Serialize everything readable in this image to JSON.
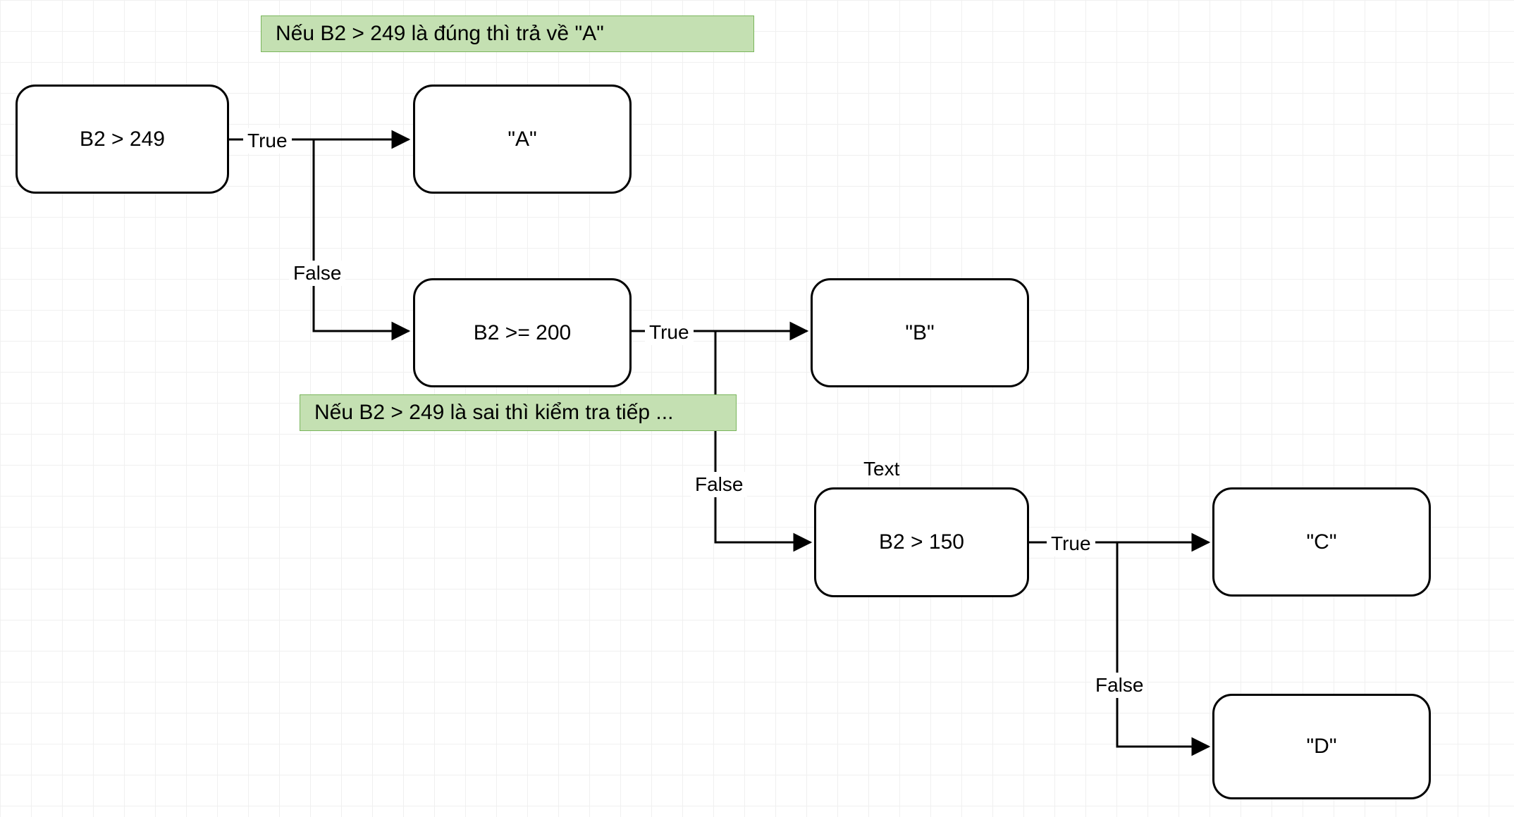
{
  "nodes": {
    "cond1": {
      "text": "B2 > 249"
    },
    "resA": {
      "text": "\"A\""
    },
    "cond2": {
      "text": "B2 >= 200"
    },
    "resB": {
      "text": "\"B\""
    },
    "cond3": {
      "text": "B2 > 150"
    },
    "resC": {
      "text": "\"C\""
    },
    "resD": {
      "text": "\"D\""
    }
  },
  "callouts": {
    "top": "Nếu B2 > 249 là đúng thì trả về \"A\"",
    "middle": "Nếu B2 > 249 là sai thì kiểm tra tiếp ..."
  },
  "edge_labels": {
    "e1_true": "True",
    "e1_false": "False",
    "e2_true": "True",
    "e2_false": "False",
    "e3_true": "True",
    "e3_false": "False"
  },
  "misc": {
    "text_label": "Text"
  },
  "colors": {
    "grid": "#f0f0f0",
    "stroke": "#000000",
    "callout_bg": "#c4e0b2",
    "callout_border": "#7ab55c"
  }
}
